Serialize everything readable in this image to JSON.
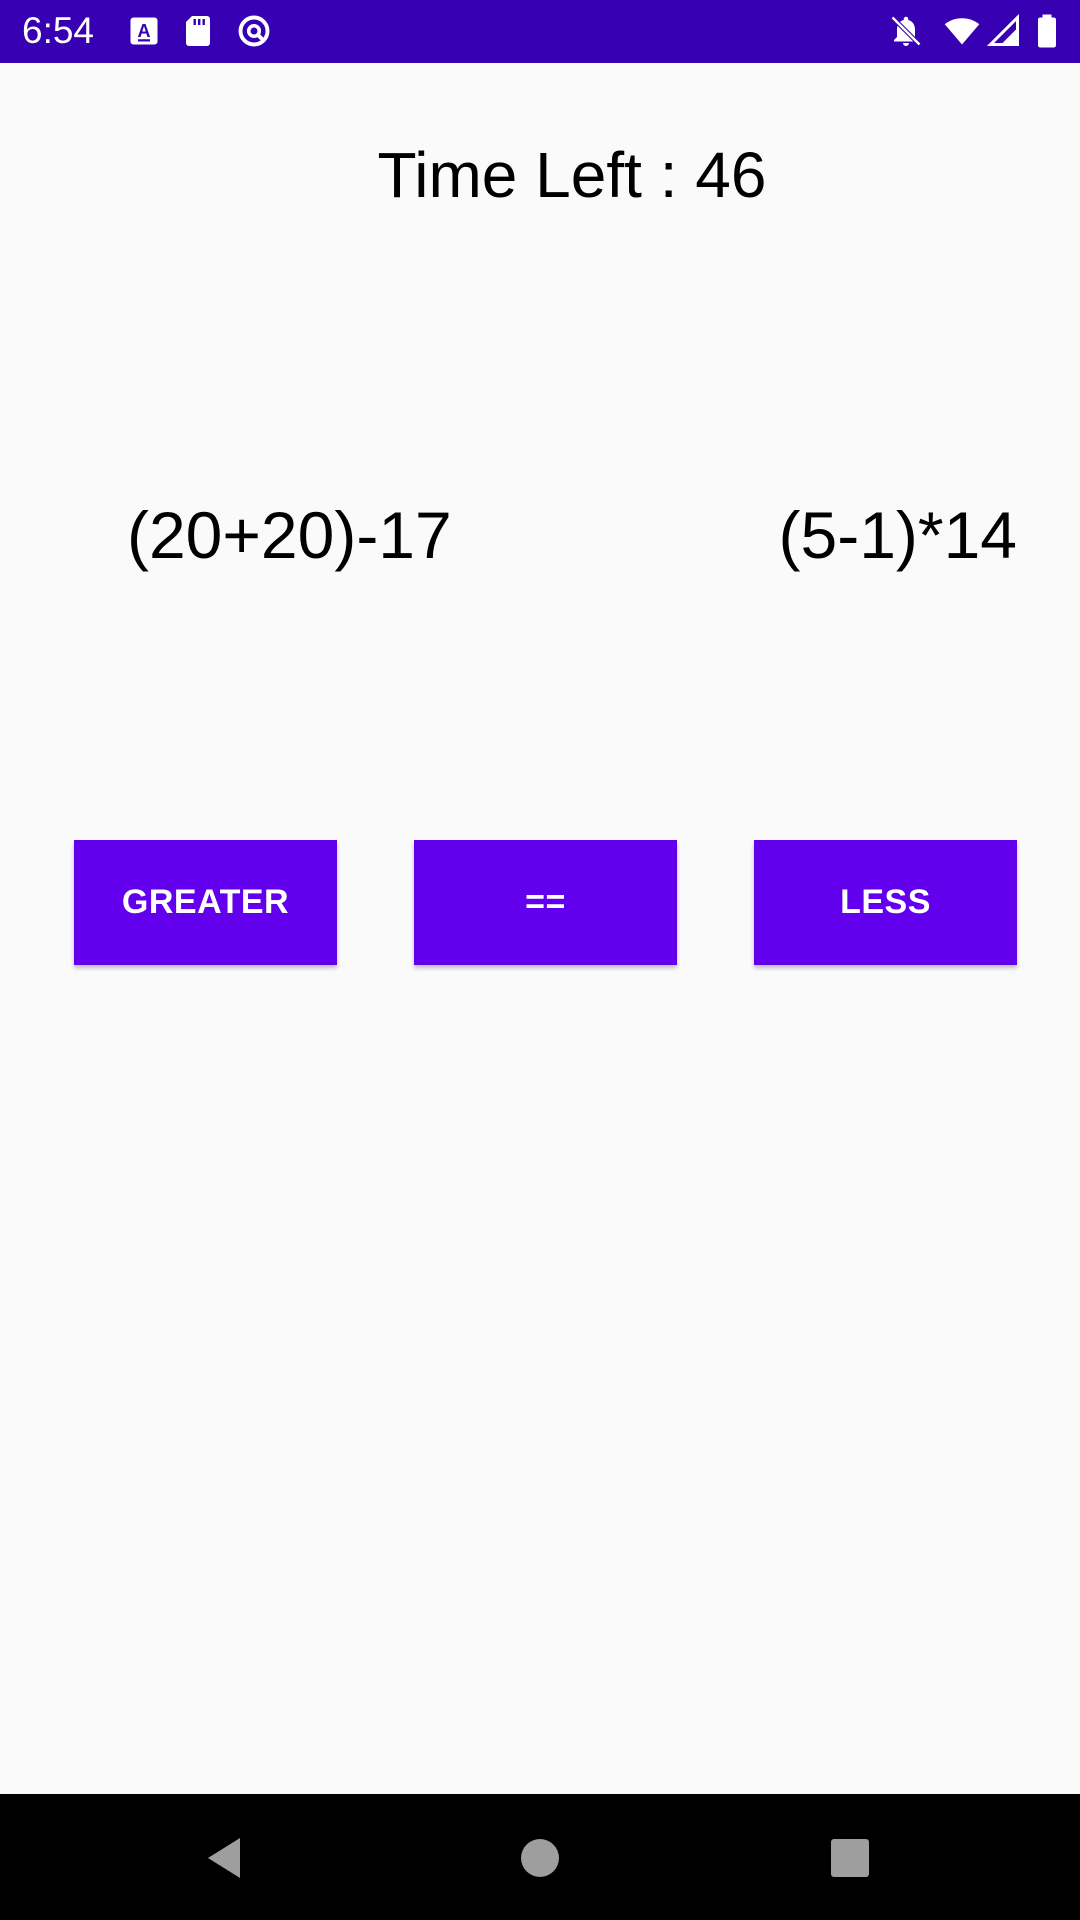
{
  "status_bar": {
    "time": "6:54",
    "background_color": "#3700b3",
    "left_icons": [
      "keyboard-a-icon",
      "sd-card-icon",
      "sync-circle-icon"
    ],
    "right_icons": [
      "notifications-off-icon",
      "wifi-icon",
      "signal-icon",
      "battery-icon"
    ]
  },
  "game": {
    "timer_text": "Time Left : 46",
    "left_expression": "(20+20)-17",
    "right_expression": "(5-1)*14"
  },
  "buttons": {
    "greater_label": "GREATER",
    "equal_label": "==",
    "less_label": "LESS",
    "color": "#6200ee"
  },
  "nav_bar": {
    "icons": [
      "back-icon",
      "home-icon",
      "recents-icon"
    ]
  }
}
